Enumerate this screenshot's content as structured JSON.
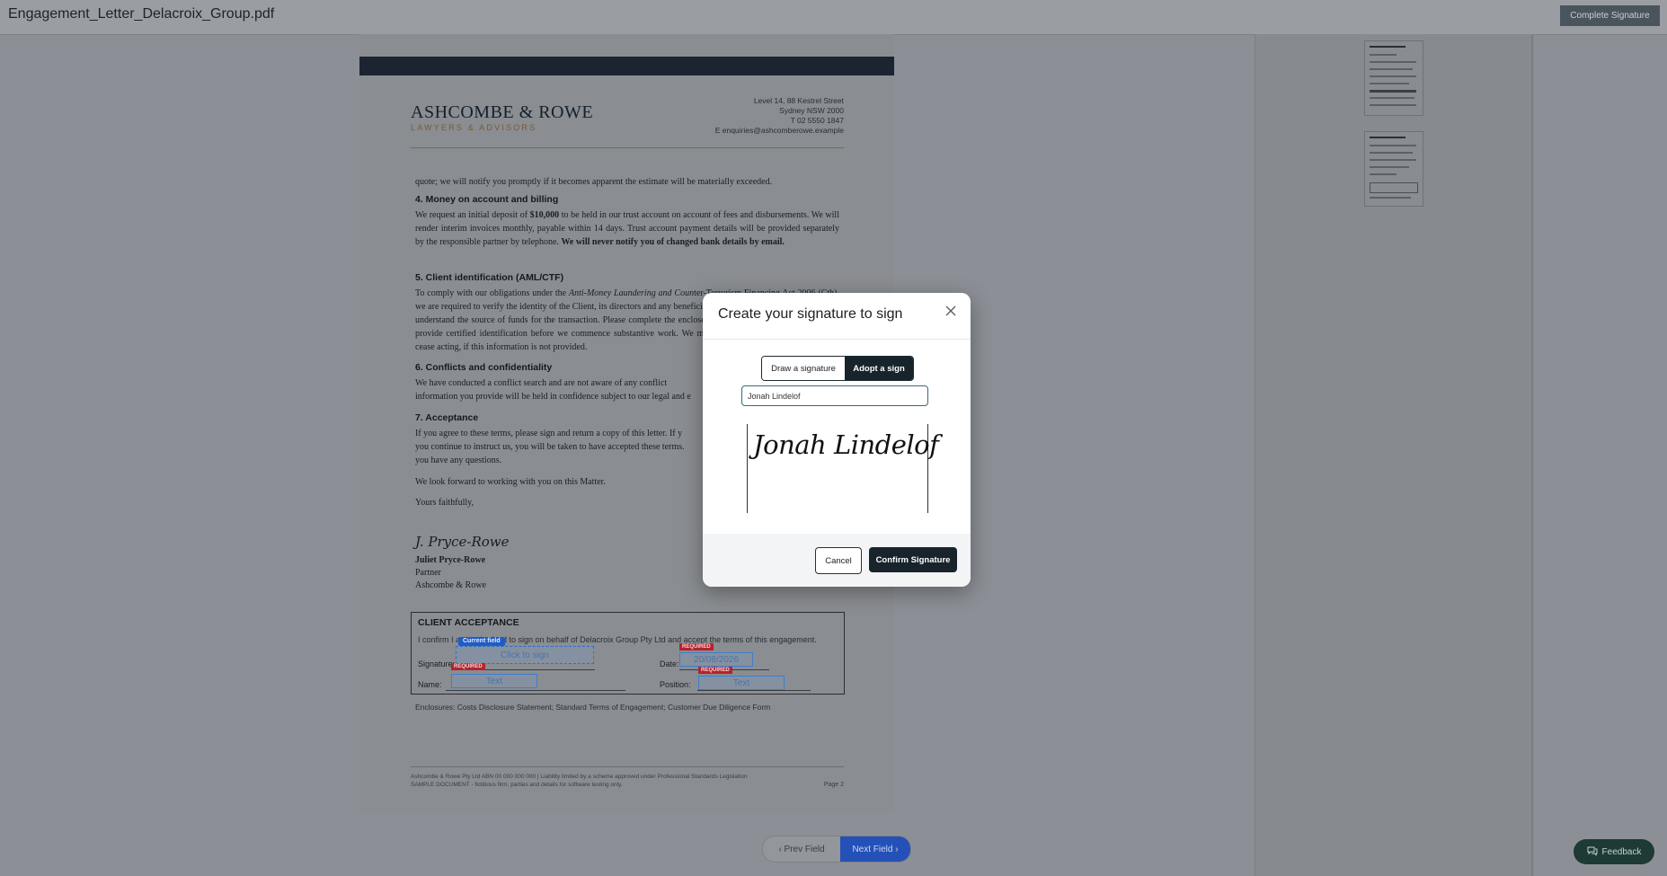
{
  "header": {
    "filename": "Engagement_Letter_Delacroix_Group.pdf",
    "complete_label": "Complete Signature"
  },
  "letter": {
    "firm_name": "ASHCOMBE & ROWE",
    "firm_subtitle": "LAWYERS & ADVISORS",
    "address": [
      "Level 14, 88 Kestrel Street",
      "Sydney NSW 2000",
      "T  02 5550 1847",
      "E  enquiries@ashcomberowe.example"
    ],
    "intro": "quote; we will notify you promptly if it becomes apparent the estimate will be materially exceeded.",
    "sec4_heading": "4. Money on account and billing",
    "sec4_a": "We request an initial deposit of ",
    "sec4_amount": "$10,000",
    "sec4_b": " to be held in our trust account on account of fees and disbursements. We will render interim invoices monthly, payable within 14 days. Trust account payment details will be provided separately by the responsible partner by telephone. ",
    "sec4_bold": "We will never notify you of changed bank details by email.",
    "sec5_heading": "5. Client identification (AML/CTF)",
    "sec5_a": "To comply with our obligations under the ",
    "sec5_italic": "Anti-Money Laundering and Coun",
    "sec5_b": "ter-Terrorism Financing Act 2006",
    "sec5_c": " (Cth), we are required to verify the identity of the Client, its directors and an",
    "sec5_d": "y beneficial owner holding 25% or more, and to understand the source of funds for the transaction. Please co",
    "sec5_e": "mplete the enclosed Customer Due Diligence form and provide certified identification before we commence s",
    "sec5_f": "ubstantive work. We may be unable to act, or may need to cease acting, if this information is not provided.",
    "sec6_heading": "6. Conflicts and confidentiality",
    "sec6_a": "We have conducted a conflict search and are not aware of any conflict",
    "sec6_b": "information you provide will be held in confidence subject to our legal and e",
    "sec7_heading": "7. Acceptance",
    "sec7_a": "If you agree to these terms, please sign and return a copy of this letter. If y",
    "sec7_b": "you continue to instruct us, you will be taken to have accepted these terms.",
    "sec7_c": "you have any questions.",
    "look_forward": "We look forward to working with you on this Matter.",
    "closing": "Yours faithfully,",
    "sender_sig": "J. Pryce-Rowe",
    "sender_name": "Juliet Pryce-Rowe",
    "sender_title": "Partner",
    "sender_firm": "Ashcombe & Rowe"
  },
  "acceptance": {
    "title": "CLIENT ACCEPTANCE",
    "line": "I confirm I am authorised to sign on behalf of Delacroix Group Pty Ltd and accept the terms of this engagement.",
    "current_field": "Current field",
    "signature_label": "Signature:",
    "click_to_sign": "Click to sign",
    "required": "REQUIRED",
    "date_label": "Date:",
    "date_value": "20/08/2026",
    "name_label": "Name:",
    "position_label": "Position:",
    "text_placeholder": "Text"
  },
  "enclosures": "Enclosures: Costs Disclosure Statement; Standard Terms of Engagement; Customer Due Diligence Form",
  "footer": {
    "line1": "Ashcombe & Rowe Pty Ltd  ABN 00 000 000 000  |  Liability limited by a scheme approved under Professional Standards Legislation",
    "line2": "SAMPLE DOCUMENT - fictitious firm, parties and details for software testing only.",
    "page": "Page 2"
  },
  "nav": {
    "prev": "Prev Field",
    "next": "Next Field",
    "feedback": "Feedback"
  },
  "modal": {
    "title": "Create your signature to sign",
    "tab_draw": "Draw a signature",
    "tab_adopt": "Adopt a sign",
    "name_value": "Jonah Lindelof",
    "preview": "Jonah Lindelof",
    "cancel": "Cancel",
    "confirm": "Confirm Signature"
  }
}
